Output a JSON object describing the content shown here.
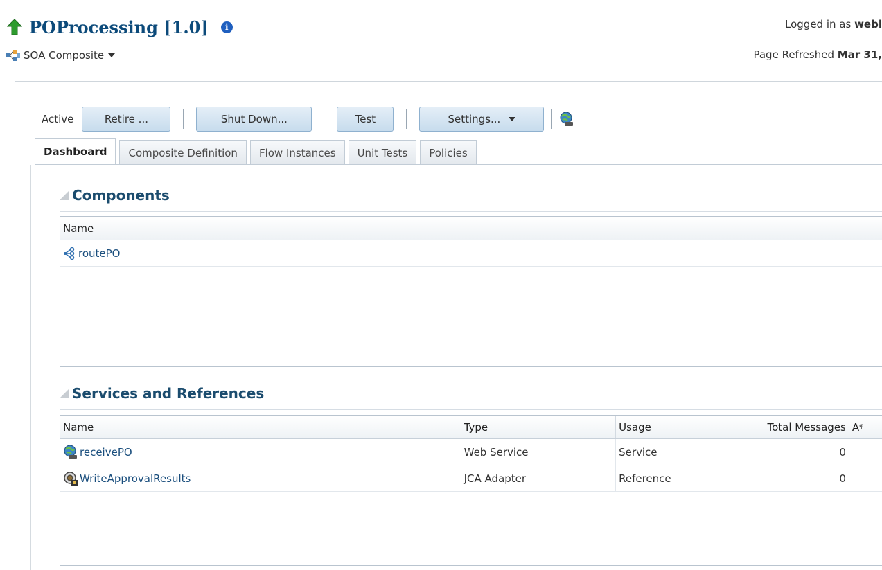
{
  "header": {
    "title": "POProcessing [1.0]",
    "target_type": "SOA Composite",
    "logged_in_prefix": "Logged in as",
    "logged_in_user": "webl",
    "refreshed_prefix": "Page Refreshed",
    "refreshed_value": "Mar 31,"
  },
  "toolbar": {
    "status": "Active",
    "retire_label": "Retire ...",
    "shutdown_label": "Shut Down...",
    "test_label": "Test",
    "settings_label": "Settings..."
  },
  "tabs": [
    {
      "label": "Dashboard"
    },
    {
      "label": "Composite Definition"
    },
    {
      "label": "Flow Instances"
    },
    {
      "label": "Unit Tests"
    },
    {
      "label": "Policies"
    }
  ],
  "components": {
    "title": "Components",
    "columns": [
      "Name"
    ],
    "rows": [
      {
        "name": "routePO",
        "icon": "mediator-icon"
      }
    ]
  },
  "services": {
    "title": "Services and References",
    "columns": [
      "Name",
      "Type",
      "Usage",
      "Total Messages",
      "Aᵠ"
    ],
    "rows": [
      {
        "name": "receivePO",
        "icon": "web-service-icon",
        "type": "Web Service",
        "usage": "Service",
        "total": "0"
      },
      {
        "name": "WriteApprovalResults",
        "icon": "jca-adapter-icon",
        "type": "JCA Adapter",
        "usage": "Reference",
        "total": "0"
      }
    ]
  },
  "colors": {
    "title": "#0c4a7a",
    "link": "#1a4e7d",
    "button_border": "#8fb1cf",
    "status_up": "#2e9b2e"
  }
}
